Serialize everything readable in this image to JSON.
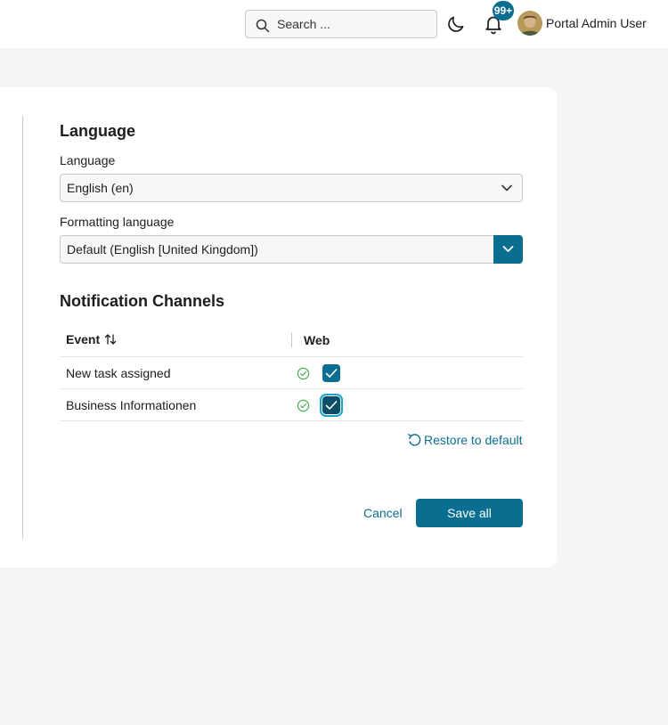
{
  "header": {
    "search": {
      "placeholder": "Search ..."
    },
    "notifications": {
      "badge": "99+"
    },
    "user": {
      "name": "Portal Admin User"
    }
  },
  "language_section": {
    "title": "Language",
    "language_label": "Language",
    "language_value": "English (en)",
    "formatting_label": "Formatting language",
    "formatting_value": "Default (English [United Kingdom])"
  },
  "notifications_section": {
    "title": "Notification Channels",
    "columns": {
      "event": "Event",
      "web": "Web"
    },
    "rows": [
      {
        "event": "New task assigned",
        "web_checked": true
      },
      {
        "event": "Business Informationen",
        "web_checked": true
      }
    ],
    "restore_label": "Restore to default"
  },
  "actions": {
    "cancel": "Cancel",
    "save": "Save all"
  },
  "colors": {
    "accent": "#0a6e91",
    "success": "#4caf50",
    "background": "#f5f5f5"
  }
}
